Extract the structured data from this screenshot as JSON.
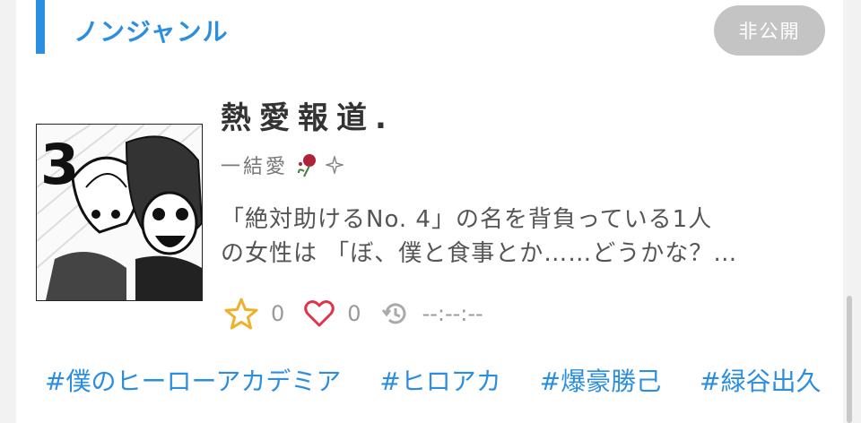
{
  "genre": {
    "label": "ノンジャンル"
  },
  "status_badge": "非公開",
  "work": {
    "title": "熱愛報道.",
    "subtitle": "一結愛",
    "description": "「絶対助けるNo. 4」の名を背負っている1人\nの女性は 「ぼ、僕と食事とか……どうかな？…",
    "thumbnail_text": "3"
  },
  "stats": {
    "stars": "0",
    "hearts": "0",
    "updated": "--:--:--"
  },
  "tags": [
    "#僕のヒーローアカデミア",
    "#ヒロアカ",
    "#爆豪勝己",
    "#緑谷出久"
  ],
  "colors": {
    "accent": "#2b8ee0",
    "badge": "#c4c4c4",
    "star": "#f0b12a",
    "heart": "#e0334a"
  },
  "icons": {
    "star": "star-icon",
    "heart": "heart-icon",
    "history": "history-icon",
    "rose": "rose-icon",
    "sparkle": "sparkle-icon"
  }
}
